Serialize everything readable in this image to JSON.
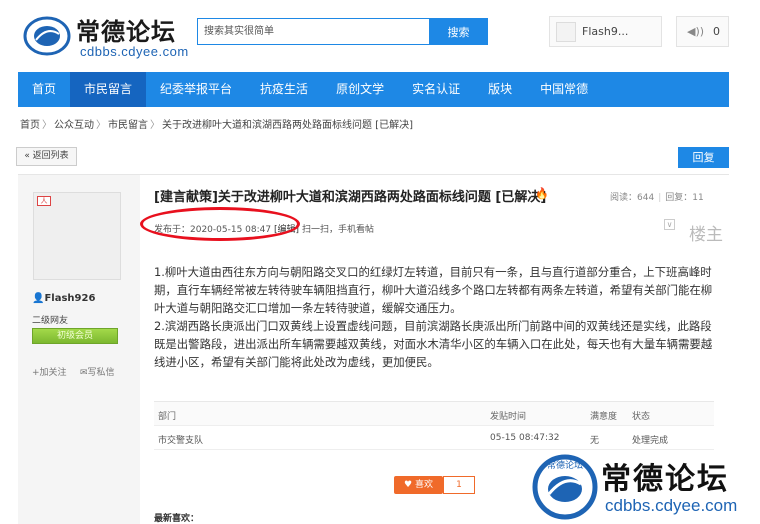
{
  "header": {
    "logo_title": "常德论坛",
    "logo_sub": "cdbbs.cdyee.com",
    "logo_ring_text": "常德论坛",
    "search_placeholder": "搜索其实很简单",
    "search_button": "搜索",
    "username": "Flash9...",
    "message_count": "0"
  },
  "nav": {
    "items": [
      "首页",
      "市民留言",
      "纪委举报平台",
      "抗疫生活",
      "原创文学",
      "实名认证",
      "版块",
      "中国常德"
    ],
    "active_index": 1
  },
  "breadcrumb": [
    "首页",
    "公众互动",
    "市民留言",
    "关于改进柳叶大道和滨湖西路两处路面标线问题 [已解决]"
  ],
  "buttons": {
    "back": "« 返回列表",
    "reply": "回复"
  },
  "author": {
    "avatar_badge": "人",
    "name": "Flash926",
    "level": "二级网友",
    "group_badge": "初级会员",
    "follow": "+加关注",
    "message": "写私信"
  },
  "post": {
    "title": "[建言献策]关于改进柳叶大道和滨湖西路两处路面标线问题 [已解决]",
    "views": "阅读：644",
    "replies": "回复：11",
    "posted_at": "发布于：2020-05-15 08:47",
    "edit_label": "[编辑]",
    "scan": "扫一扫，手机看帖",
    "floor": "楼主",
    "paragraphs": [
      "1.柳叶大道由西往东方向与朝阳路交叉口的红绿灯左转道，目前只有一条，且与直行道部分重合，上下班高峰时期，直行车辆经常被左转待驶车辆阻挡直行，柳叶大道沿线多个路口左转都有两条左转道，希望有关部门能在柳叶大道与朝阳路交汇口增加一条左转待驶道，缓解交通压力。",
      "2.滨湖西路长庚派出门口双黄线上设置虚线问题，目前滨湖路长庚派出所门前路中间的双黄线还是实线，此路段既是出警路段，进出派出所车辆需要越双黄线，对面水木清华小区的车辆入口在此处，每天也有大量车辆需要越线进小区，希望有关部门能将此处改为虚线，更加便民。"
    ]
  },
  "response_table": {
    "headers": [
      "部门",
      "发贴时间",
      "满意度",
      "状态"
    ],
    "rows": [
      [
        "市交警支队",
        "05-15 08:47:32",
        "无",
        "处理完成"
      ]
    ]
  },
  "likes": {
    "label": "喜欢",
    "count": "1"
  },
  "recent_likes_label": "最新喜欢：",
  "watermark": {
    "title": "常德论坛",
    "sub": "cdbbs.cdyee.com"
  },
  "colors": {
    "brand_blue": "#1e88e5",
    "nav_active": "#1565c0",
    "highlight_red": "#e8101e",
    "like_orange": "#f06a2a"
  }
}
